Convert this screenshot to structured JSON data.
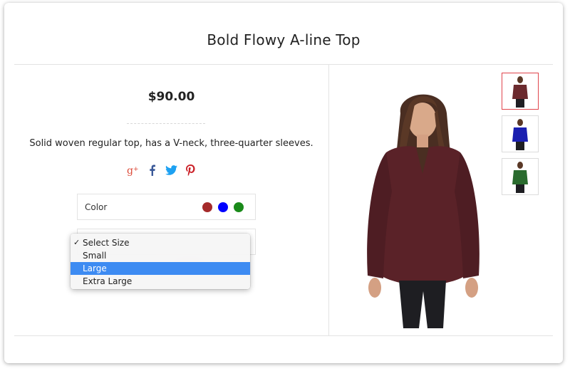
{
  "product": {
    "title": "Bold Flowy A-line Top",
    "price": "$90.00",
    "description": "Solid woven regular top, has a V-neck, three-quarter sleeves."
  },
  "social": [
    "google-plus-icon",
    "facebook-icon",
    "twitter-icon",
    "pinterest-icon"
  ],
  "color_selector": {
    "label": "Color",
    "options": [
      {
        "name": "maroon",
        "hex": "#a52a2a"
      },
      {
        "name": "blue",
        "hex": "#0000ff"
      },
      {
        "name": "green",
        "hex": "#1a8a1a"
      }
    ]
  },
  "size_dropdown": {
    "options": [
      "Select Size",
      "Small",
      "Large",
      "Extra Large"
    ],
    "checked": "Select Size",
    "highlighted": "Large"
  },
  "thumbnails": [
    {
      "color": "#6b2a2e",
      "active": true
    },
    {
      "color": "#1a1fb0",
      "active": false
    },
    {
      "color": "#2a6b2e",
      "active": false
    }
  ],
  "colors": {
    "shirt": "#5a2228",
    "highlight": "#3d8bf2",
    "active_thumb_border": "#e0454c"
  }
}
